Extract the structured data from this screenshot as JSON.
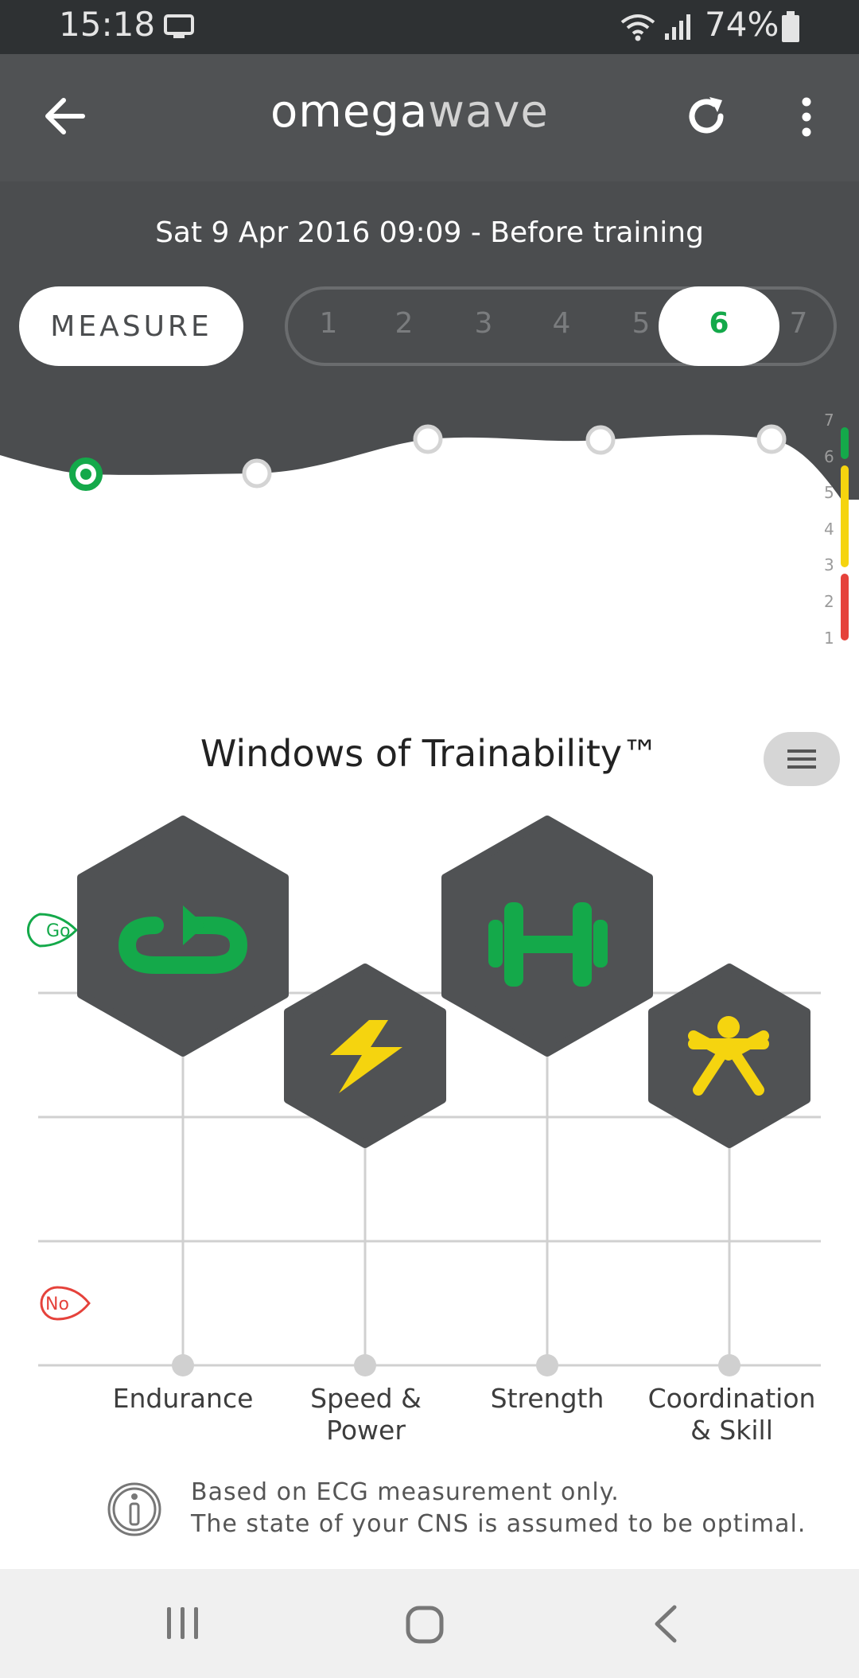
{
  "status_bar": {
    "time": "15:18",
    "battery": "74%",
    "icons": [
      "monitor-icon",
      "wifi-icon",
      "signal-icon",
      "battery-icon"
    ]
  },
  "app_bar": {
    "logo_bold": "omega",
    "logo_light": "wave",
    "back_icon": "arrow-left-icon",
    "refresh_icon": "refresh-icon",
    "more_icon": "more-vertical-icon"
  },
  "session": {
    "label": "Sat 9 Apr 2016 09:09 - Before training"
  },
  "measure_button": "MEASURE",
  "day_selector": {
    "days": [
      "1",
      "2",
      "3",
      "4",
      "5",
      "6",
      "7"
    ],
    "selected": "6"
  },
  "readiness_scale": [
    "7",
    "6",
    "5",
    "4",
    "3",
    "2",
    "1"
  ],
  "colors": {
    "go": "#14a94a",
    "caution": "#f5d40f",
    "stop": "#e5423b",
    "hex": "#505254"
  },
  "windows": {
    "title": "Windows of Trainability™",
    "go_label": "Go",
    "no_label": "No",
    "categories": [
      {
        "name": "Endurance",
        "icon": "endurance-loop-icon",
        "level": "go"
      },
      {
        "name": "Speed & Power",
        "icon": "lightning-icon",
        "level": "caution"
      },
      {
        "name": "Strength",
        "icon": "dumbbell-icon",
        "level": "go"
      },
      {
        "name": "Coordination & Skill",
        "icon": "person-star-icon",
        "level": "caution"
      }
    ]
  },
  "info": {
    "line1": "Based on ECG measurement only.",
    "line2": "The state of your CNS is assumed to be optimal."
  },
  "nav_bar": {
    "icons": [
      "recent-apps-icon",
      "home-icon",
      "back-nav-icon"
    ]
  }
}
